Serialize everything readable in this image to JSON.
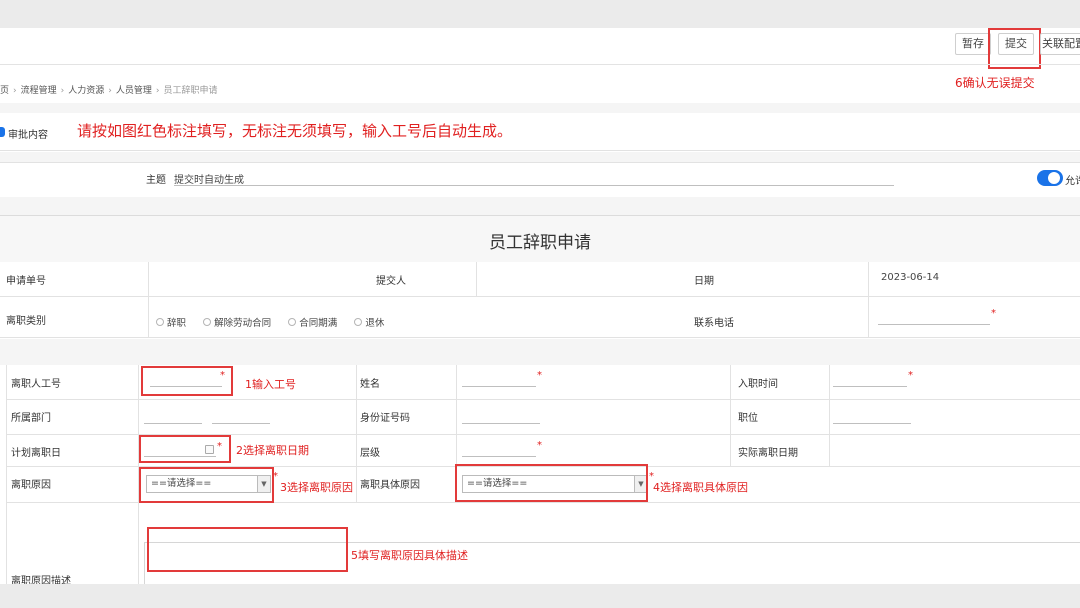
{
  "toolbar": {
    "draft_label": "暂存",
    "submit_label": "提交",
    "config_label": "关联配置",
    "submit_note": "6确认无误提交"
  },
  "breadcrumb": {
    "items": [
      "页",
      "流程管理",
      "人力资源",
      "人员管理",
      "员工辞职申请"
    ]
  },
  "approval": {
    "label": "审批内容",
    "instruction": "请按如图红色标注填写，无标注无须填写，输入工号后自动生成。"
  },
  "subject": {
    "label": "主题",
    "value": "提交时自动生成",
    "toggle_label": "允许"
  },
  "form": {
    "title": "员工辞职申请",
    "request_no_label": "申请单号",
    "submitter_label": "提交人",
    "date_label": "日期",
    "date_value": "2023-06-14",
    "category_label": "离职类别",
    "category_options": [
      "辞职",
      "解除劳动合同",
      "合同期满",
      "退休"
    ],
    "phone_label": "联系电话",
    "employee_no_label": "离职人工号",
    "name_label": "姓名",
    "hire_date_label": "入职时间",
    "dept_label": "所属部门",
    "id_label": "身份证号码",
    "position_label": "职位",
    "planned_date_label": "计划离职日",
    "level_label": "层级",
    "actual_date_label": "实际离职日期",
    "reason_label": "离职原因",
    "reason_select": "==请选择==",
    "detail_reason_label": "离职具体原因",
    "detail_reason_select": "==请选择==",
    "description_label": "离职原因描述",
    "required_mark": "*"
  },
  "annotations": {
    "a1": "1输入工号",
    "a2": "2选择离职日期",
    "a3": "3选择离职原因",
    "a4": "4选择离职具体原因",
    "a5": "5填写离职原因具体描述"
  },
  "colors": {
    "annotation_red": "#e02020",
    "toggle_blue": "#1a73e8"
  }
}
